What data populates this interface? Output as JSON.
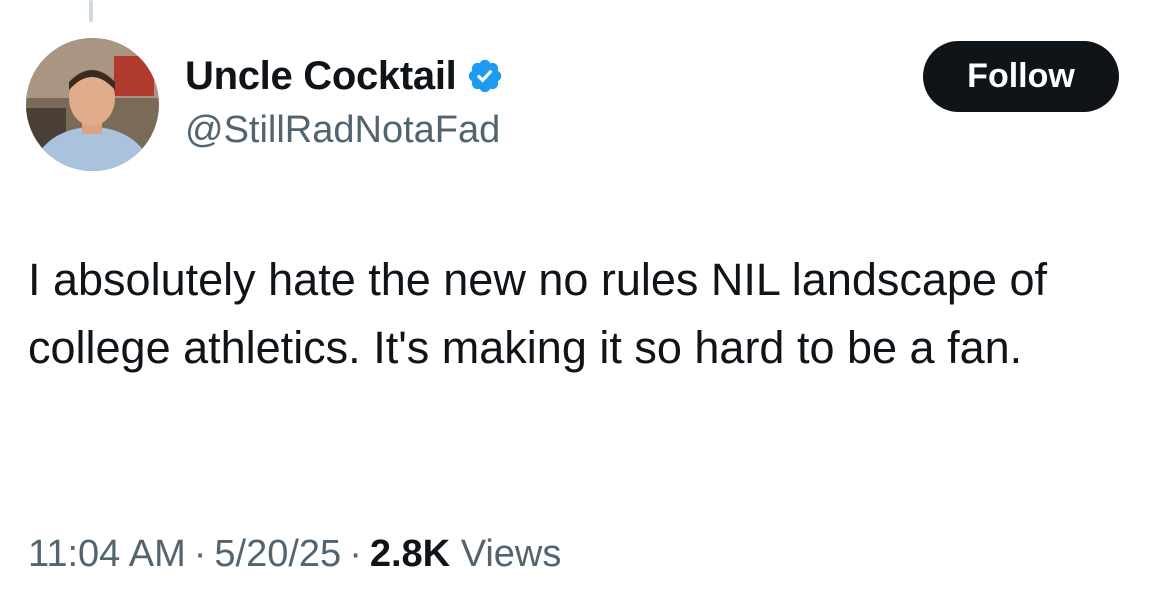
{
  "author": {
    "display_name": "Uncle Cocktail",
    "handle": "@StillRadNotaFad",
    "verified_icon": "verified-badge-icon",
    "avatar_icon": "profile-photo"
  },
  "actions": {
    "follow_label": "Follow"
  },
  "tweet": {
    "text": "I absolutely hate the new no rules NIL landscape of college athletics. It's making it so hard to be a fan."
  },
  "meta": {
    "time": "11:04 AM",
    "separator": "·",
    "date": "5/20/25",
    "views_count": "2.8K",
    "views_label": "Views"
  },
  "colors": {
    "text_primary": "#0f1419",
    "text_secondary": "#536471",
    "verified_blue": "#1d9bf0",
    "button_bg": "#0f1419"
  }
}
